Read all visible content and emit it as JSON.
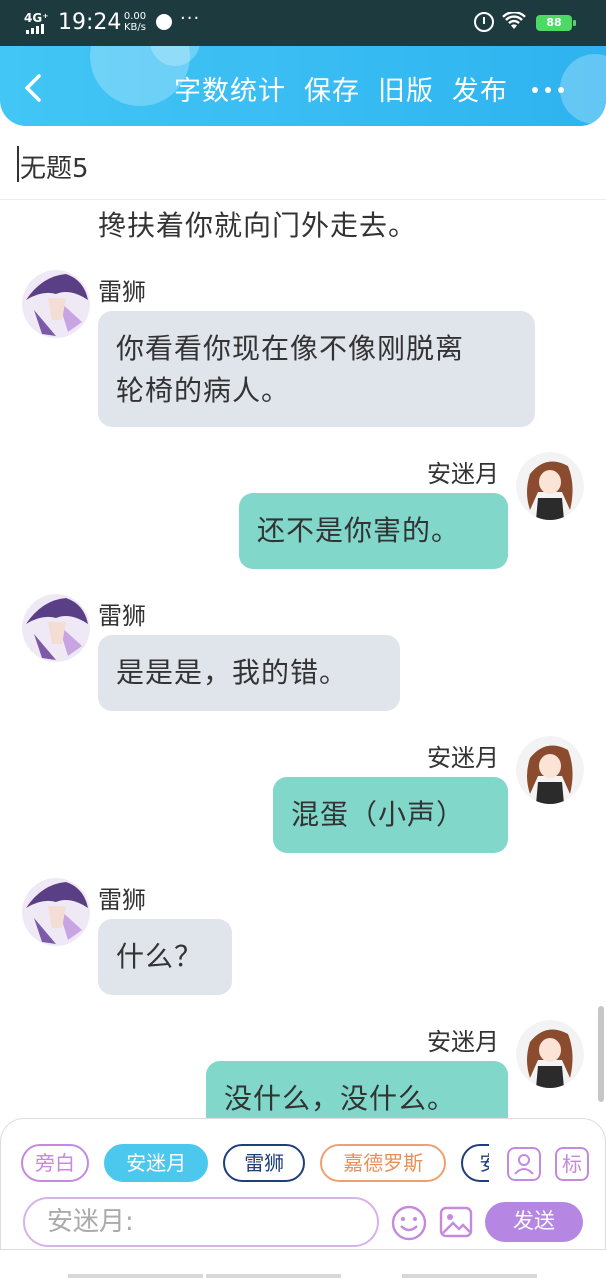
{
  "status_bar": {
    "network": "4G⁺",
    "time": "19:24",
    "speed_value": "0.00",
    "speed_unit": "KB/s",
    "battery": "88"
  },
  "header": {
    "actions": [
      "字数统计",
      "保存",
      "旧版",
      "发布"
    ]
  },
  "document": {
    "title": "无题5"
  },
  "chat": {
    "narration": "搀扶着你就向门外走去。",
    "messages": [
      {
        "side": "left",
        "speaker": "雷狮",
        "text_lines": [
          "你看看你现在像不像刚脱离",
          "轮椅的病人。"
        ]
      },
      {
        "side": "right",
        "speaker": "安迷月",
        "text": "还不是你害的。"
      },
      {
        "side": "left",
        "speaker": "雷狮",
        "text": "是是是，我的错。"
      },
      {
        "side": "right",
        "speaker": "安迷月",
        "text": "混蛋（小声）"
      },
      {
        "side": "left",
        "speaker": "雷狮",
        "text": "什么？"
      },
      {
        "side": "right",
        "speaker": "安迷月",
        "text": "没什么，没什么。"
      }
    ]
  },
  "composer": {
    "characters": [
      {
        "label": "旁白",
        "style": "outline",
        "color": "#c58adf"
      },
      {
        "label": "安迷月",
        "style": "filled",
        "color": "#4cc8ef"
      },
      {
        "label": "雷狮",
        "style": "outline",
        "color": "#1f3f7a"
      },
      {
        "label": "嘉德罗斯",
        "style": "outline",
        "color": "#f0a070"
      },
      {
        "label": "安",
        "style": "outline",
        "color": "#1f3f7a"
      }
    ],
    "tag_button": "标",
    "placeholder": "安迷月:",
    "send_label": "发送"
  }
}
